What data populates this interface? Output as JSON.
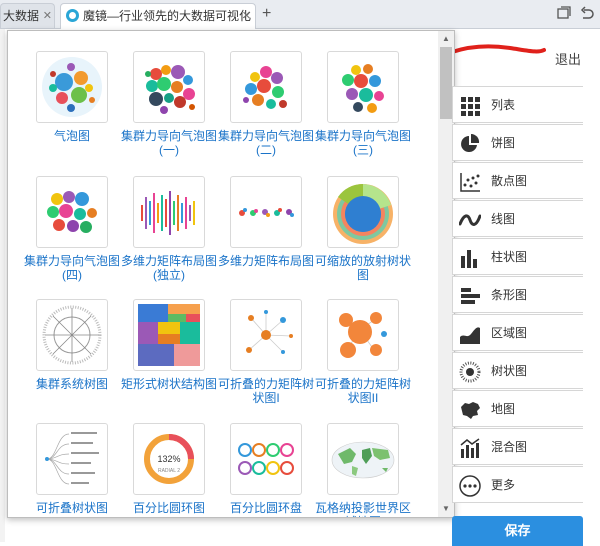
{
  "browser": {
    "tabs": [
      {
        "label": "大数据"
      },
      {
        "label": "魔镜—行业领先的大数据可视化"
      }
    ],
    "new_tab": "+"
  },
  "header": {
    "logout_label": "退出"
  },
  "chart_gallery": [
    {
      "label": "气泡图"
    },
    {
      "label": "集群力导向气泡图(一)"
    },
    {
      "label": "集群力导向气泡图(二)"
    },
    {
      "label": "集群力导向气泡图(三)"
    },
    {
      "label": "集群力导向气泡图(四)"
    },
    {
      "label": "多维力矩阵布局图(独立)"
    },
    {
      "label": "多维力矩阵布局图"
    },
    {
      "label": "可缩放的放射树状图"
    },
    {
      "label": "集群系统树图"
    },
    {
      "label": "矩形式树状结构图"
    },
    {
      "label": "可折叠的力矩阵树状图I"
    },
    {
      "label": "可折叠的力矩阵树状图II"
    },
    {
      "label": "可折叠树状图"
    },
    {
      "label": "百分比圆环图"
    },
    {
      "label": "百分比圆环盘"
    },
    {
      "label": "瓦格纳投影世界区域地图"
    }
  ],
  "thumb_text": {
    "percent": "132%",
    "radial": "RADIAL 2"
  },
  "sidebar": {
    "items": [
      {
        "label": "列表",
        "icon": "grid-icon"
      },
      {
        "label": "饼图",
        "icon": "pie-icon"
      },
      {
        "label": "散点图",
        "icon": "scatter-icon"
      },
      {
        "label": "线图",
        "icon": "line-icon"
      },
      {
        "label": "柱状图",
        "icon": "column-icon"
      },
      {
        "label": "条形图",
        "icon": "bar-icon"
      },
      {
        "label": "区域图",
        "icon": "area-icon"
      },
      {
        "label": "树状图",
        "icon": "tree-icon"
      },
      {
        "label": "地图",
        "icon": "map-icon"
      },
      {
        "label": "混合图",
        "icon": "mixed-icon"
      },
      {
        "label": "更多",
        "icon": "more-icon"
      }
    ]
  },
  "footer": {
    "save_label": "保存"
  },
  "colors": {
    "link": "#1a73c8",
    "accent": "#2b8fe0",
    "icon_dark": "#333333"
  }
}
